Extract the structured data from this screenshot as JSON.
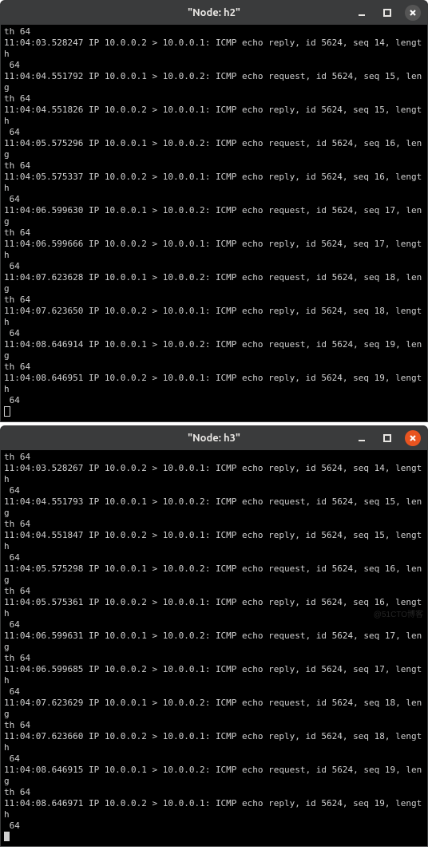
{
  "watermark": "@51CTO博客",
  "windows": [
    {
      "title": "\"Node: h2\"",
      "close_style": "gray",
      "cursor_style": "hollow",
      "prelude": "th 64",
      "packets": [
        {
          "ts": "11:04:03.528247",
          "src": "10.0.0.2",
          "dst": "10.0.0.1",
          "type": "ICMP echo reply",
          "id": "5624",
          "seq": "14",
          "wrapped": false
        },
        {
          "ts": "11:04:04.551792",
          "src": "10.0.0.1",
          "dst": "10.0.0.2",
          "type": "ICMP echo request",
          "id": "5624",
          "seq": "15",
          "wrapped": true
        },
        {
          "ts": "11:04:04.551826",
          "src": "10.0.0.2",
          "dst": "10.0.0.1",
          "type": "ICMP echo reply",
          "id": "5624",
          "seq": "15",
          "wrapped": false
        },
        {
          "ts": "11:04:05.575296",
          "src": "10.0.0.1",
          "dst": "10.0.0.2",
          "type": "ICMP echo request",
          "id": "5624",
          "seq": "16",
          "wrapped": true
        },
        {
          "ts": "11:04:05.575337",
          "src": "10.0.0.2",
          "dst": "10.0.0.1",
          "type": "ICMP echo reply",
          "id": "5624",
          "seq": "16",
          "wrapped": false
        },
        {
          "ts": "11:04:06.599630",
          "src": "10.0.0.1",
          "dst": "10.0.0.2",
          "type": "ICMP echo request",
          "id": "5624",
          "seq": "17",
          "wrapped": true
        },
        {
          "ts": "11:04:06.599666",
          "src": "10.0.0.2",
          "dst": "10.0.0.1",
          "type": "ICMP echo reply",
          "id": "5624",
          "seq": "17",
          "wrapped": false
        },
        {
          "ts": "11:04:07.623628",
          "src": "10.0.0.1",
          "dst": "10.0.0.2",
          "type": "ICMP echo request",
          "id": "5624",
          "seq": "18",
          "wrapped": true
        },
        {
          "ts": "11:04:07.623650",
          "src": "10.0.0.2",
          "dst": "10.0.0.1",
          "type": "ICMP echo reply",
          "id": "5624",
          "seq": "18",
          "wrapped": false
        },
        {
          "ts": "11:04:08.646914",
          "src": "10.0.0.1",
          "dst": "10.0.0.2",
          "type": "ICMP echo request",
          "id": "5624",
          "seq": "19",
          "wrapped": true
        },
        {
          "ts": "11:04:08.646951",
          "src": "10.0.0.2",
          "dst": "10.0.0.1",
          "type": "ICMP echo reply",
          "id": "5624",
          "seq": "19",
          "wrapped": false
        }
      ]
    },
    {
      "title": "\"Node: h3\"",
      "close_style": "orange",
      "cursor_style": "solid",
      "prelude": "th 64",
      "packets": [
        {
          "ts": "11:04:03.528267",
          "src": "10.0.0.2",
          "dst": "10.0.0.1",
          "type": "ICMP echo reply",
          "id": "5624",
          "seq": "14",
          "wrapped": false
        },
        {
          "ts": "11:04:04.551793",
          "src": "10.0.0.1",
          "dst": "10.0.0.2",
          "type": "ICMP echo request",
          "id": "5624",
          "seq": "15",
          "wrapped": true
        },
        {
          "ts": "11:04:04.551847",
          "src": "10.0.0.2",
          "dst": "10.0.0.1",
          "type": "ICMP echo reply",
          "id": "5624",
          "seq": "15",
          "wrapped": false
        },
        {
          "ts": "11:04:05.575298",
          "src": "10.0.0.1",
          "dst": "10.0.0.2",
          "type": "ICMP echo request",
          "id": "5624",
          "seq": "16",
          "wrapped": true
        },
        {
          "ts": "11:04:05.575361",
          "src": "10.0.0.2",
          "dst": "10.0.0.1",
          "type": "ICMP echo reply",
          "id": "5624",
          "seq": "16",
          "wrapped": false
        },
        {
          "ts": "11:04:06.599631",
          "src": "10.0.0.1",
          "dst": "10.0.0.2",
          "type": "ICMP echo request",
          "id": "5624",
          "seq": "17",
          "wrapped": true
        },
        {
          "ts": "11:04:06.599685",
          "src": "10.0.0.2",
          "dst": "10.0.0.1",
          "type": "ICMP echo reply",
          "id": "5624",
          "seq": "17",
          "wrapped": false
        },
        {
          "ts": "11:04:07.623629",
          "src": "10.0.0.1",
          "dst": "10.0.0.2",
          "type": "ICMP echo request",
          "id": "5624",
          "seq": "18",
          "wrapped": true
        },
        {
          "ts": "11:04:07.623660",
          "src": "10.0.0.2",
          "dst": "10.0.0.1",
          "type": "ICMP echo reply",
          "id": "5624",
          "seq": "18",
          "wrapped": false
        },
        {
          "ts": "11:04:08.646915",
          "src": "10.0.0.1",
          "dst": "10.0.0.2",
          "type": "ICMP echo request",
          "id": "5624",
          "seq": "19",
          "wrapped": true
        },
        {
          "ts": "11:04:08.646971",
          "src": "10.0.0.2",
          "dst": "10.0.0.1",
          "type": "ICMP echo reply",
          "id": "5624",
          "seq": "19",
          "wrapped": false
        }
      ]
    }
  ]
}
